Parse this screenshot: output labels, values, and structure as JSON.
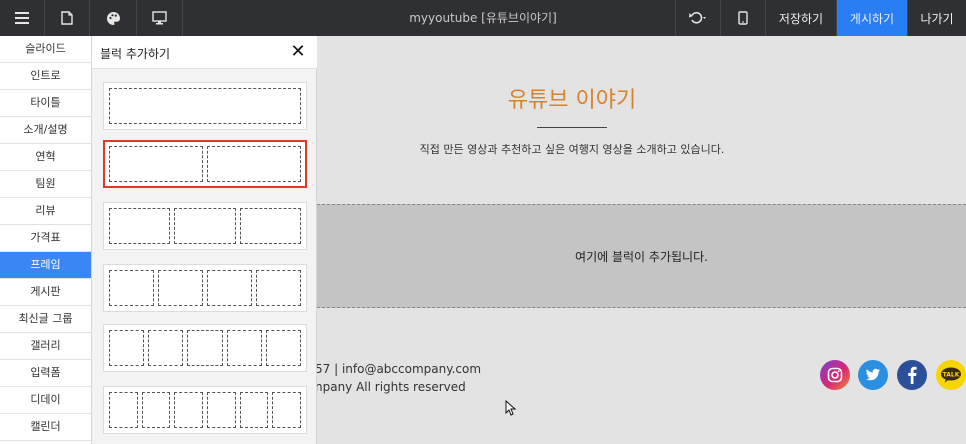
{
  "topbar": {
    "title": "myyoutube [유튜브이야기]",
    "save_label": "저장하기",
    "publish_label": "게시하기",
    "exit_label": "나가기",
    "accent": "#2a7ef3"
  },
  "categories": [
    "슬라이드",
    "인트로",
    "타이틀",
    "소개/설명",
    "연혁",
    "팀원",
    "리뷰",
    "가격표",
    "프레임",
    "게시판",
    "최신글 그룹",
    "갤러리",
    "입력폼",
    "디데이",
    "캘린더"
  ],
  "selected_category": "프레임",
  "panel": {
    "title": "블럭 추가하기",
    "layouts": [
      {
        "columns": 1
      },
      {
        "columns": 2,
        "selected": true
      },
      {
        "columns": 3
      },
      {
        "columns": 4
      },
      {
        "columns": 5
      },
      {
        "columns": 6
      }
    ]
  },
  "canvas": {
    "title": "유튜브 이야기",
    "title_color": "#d9822b",
    "description": "직접 만든 영상과 추천하고 싶은 여행지 영상을 소개하고 있습니다.",
    "dropzone_text": "여기에 블럭이 추가됩니다.",
    "footer_contact": "57 | info@abccompany.com",
    "footer_copyright": "npany All rights reserved",
    "social_icons": [
      "instagram-icon",
      "twitter-icon",
      "facebook-icon",
      "kakaotalk-icon"
    ],
    "kakao_label": "TALK"
  }
}
